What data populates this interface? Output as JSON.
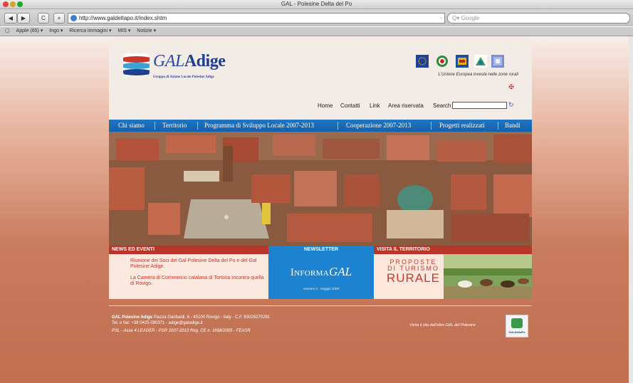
{
  "window": {
    "title": "GAL - Polesine Delta del Po"
  },
  "toolbar": {
    "back_label": "◀",
    "forward_label": "▶",
    "reload_label": "C",
    "add_label": "+",
    "url": "http://www.galdeltapo.it/index.shtm",
    "rss_label": "◦",
    "search_placeholder": "Q▾ Google"
  },
  "bookmarks": {
    "items": [
      "Apple (65) ▾",
      "Ingo ▾",
      "Ricerca immagini ▾",
      "MIS ▾",
      "Notizie ▾"
    ]
  },
  "header": {
    "logo_gal": "GAL",
    "logo_adige": "Adige",
    "logo_subtitle": "Gruppo di Azione Locale Polesine Adige",
    "eu_text": "L'Unione Europea investe nelle zone rurali",
    "toplinks": [
      "Home",
      "Contatti",
      "Link",
      "Area riservata"
    ],
    "search_label": "Search",
    "search_go": "↻"
  },
  "menu": {
    "items": [
      "Chi siamo",
      "Territorio",
      "Programma di Sviluppo Locale 2007-2013",
      "Cooperazione 2007-2013",
      "Progetti realizzati",
      "Bandi"
    ]
  },
  "news": {
    "heading": "NEWS ED EVENTI",
    "items": [
      "Riunione dei Soci del Gal Polesine Delta del Po e del Gal Polesine Adige.",
      "La Camera di Commercio catalana di Tortosa incontra quella di Rovigo."
    ]
  },
  "newsletter": {
    "heading": "NEWSLETTER",
    "title_a": "Informa",
    "title_b": "GAL",
    "issue": "Numero 0 - maggio 2009"
  },
  "territorio": {
    "heading": "VISITA IL TERRITORIO",
    "line1": "PROPOSTE",
    "line2": "DI TURISMO",
    "line3": "RURALE"
  },
  "footer": {
    "org": "GAL Polesine Adige",
    "address": "Piazza Garibaldi, 6 - 45100 Rovigo - Italy - C.F. 93026270291",
    "contact": "Tel. e fax: +39 0425 090371 - adige@galadige.it",
    "program": "PSL - Asse 4 LEADER - PSR 2007-2013 Reg. CE n. 1698/2005 - FEASR",
    "other_site": "Visita il sito dell'altro GAL del Polesine",
    "badge": "GALDeltaPo"
  },
  "colors": {
    "menu_blue": "#1668b3",
    "news_red": "#c0392b",
    "newsletter_blue": "#1d82cf",
    "background_terracotta": "#c06f50"
  }
}
